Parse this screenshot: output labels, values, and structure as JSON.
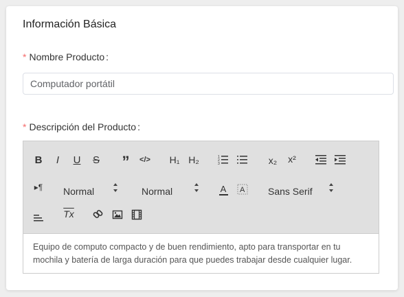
{
  "card": {
    "title": "Información Básica"
  },
  "product_name": {
    "required_mark": "*",
    "label": "Nombre Producto",
    "colon": ":",
    "value": "Computador portátil"
  },
  "description": {
    "required_mark": "*",
    "label": "Descripción del Producto",
    "colon": ":",
    "text": "Equipo de computo compacto y de buen rendimiento, apto para transportar en tu mochila y batería de larga duración para que puedes trabajar desde cualquier lugar."
  },
  "toolbar": {
    "bold": "B",
    "italic": "I",
    "underline": "U",
    "strike": "S",
    "quote": "”",
    "code": "</>",
    "h1": "H₁",
    "h2": "H₂",
    "subscript": "x₂",
    "superscript": "x²",
    "rtl": "▸¶",
    "size_select": "Normal",
    "header_select": "Normal",
    "color": "A",
    "background": "A",
    "font_select": "Sans Serif",
    "clean": "Tx"
  },
  "colors": {
    "required": "#f56c6c",
    "toolbar_bg": "#e0e0e0",
    "border": "#dcdfe6"
  }
}
